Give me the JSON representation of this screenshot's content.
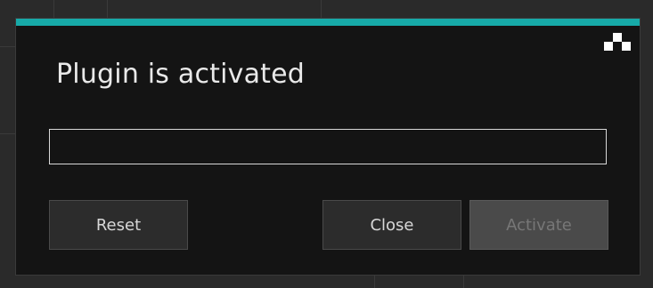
{
  "dialog": {
    "title": "Plugin is activated",
    "accent_color": "#17aaa8",
    "logo_icon": "plugin-logo-icon",
    "input": {
      "value": "",
      "placeholder": ""
    },
    "buttons": {
      "reset_label": "Reset",
      "close_label": "Close",
      "activate_label": "Activate"
    }
  }
}
